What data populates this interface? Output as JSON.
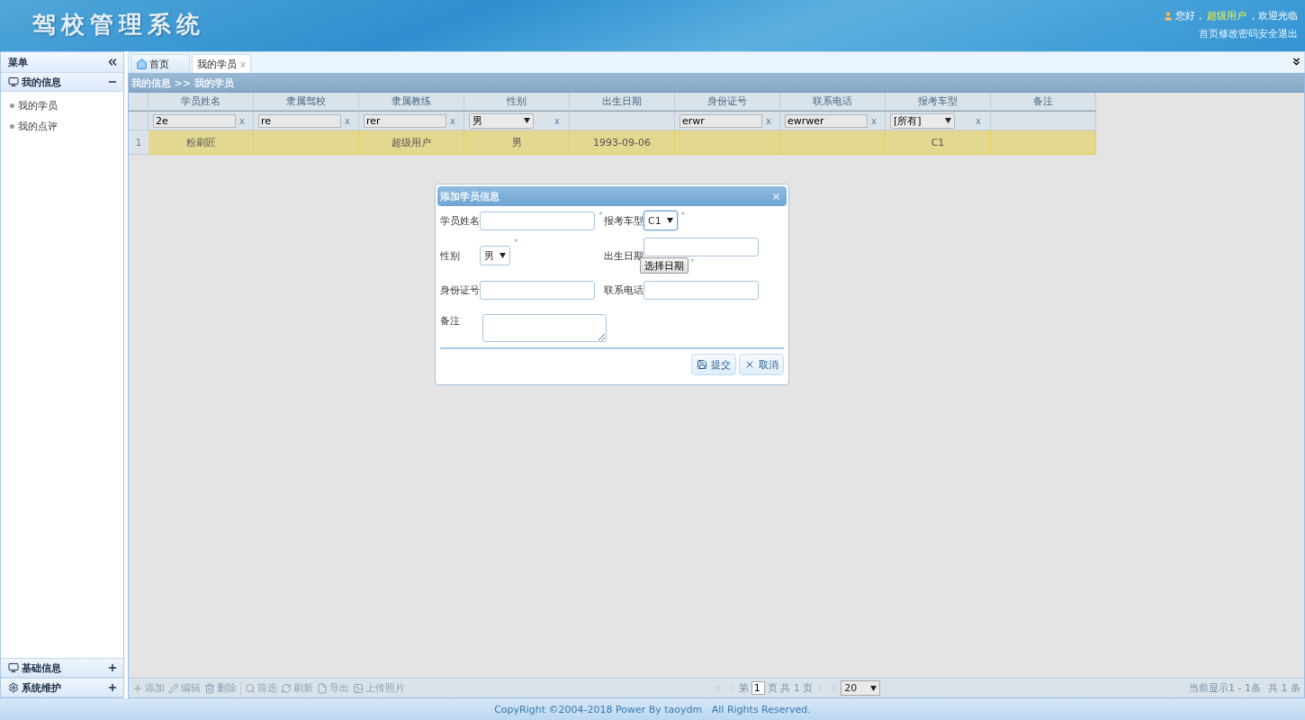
{
  "header": {
    "title": "驾校管理系统",
    "greeting": "您好，",
    "user": "超级用户",
    "welcome": "，欢迎光临",
    "links": [
      "首页",
      "修改密码",
      "安全退出"
    ]
  },
  "sidebar": {
    "title": "菜单",
    "groups": [
      {
        "label": "我的信息",
        "kind": "monitor",
        "expanded": true,
        "items": [
          {
            "label": "我的学员"
          },
          {
            "label": "我的点评"
          }
        ]
      },
      {
        "label": "基础信息",
        "kind": "monitor",
        "expanded": false
      },
      {
        "label": "系统维护",
        "kind": "gear",
        "expanded": false
      }
    ]
  },
  "tabs": [
    {
      "label": "首页",
      "kind": "home",
      "selected": false
    },
    {
      "label": "我的学员",
      "kind": "plain",
      "selected": true,
      "close": "x"
    }
  ],
  "breadcrumb": "我的信息 >> 我的学员",
  "grid": {
    "columns": [
      "学员姓名",
      "隶属驾校",
      "隶属教练",
      "性别",
      "出生日期",
      "身份证号",
      "联系电话",
      "报考车型",
      "备注"
    ],
    "filters": [
      {
        "kind": "text",
        "value": "2e",
        "clear": "x"
      },
      {
        "kind": "text",
        "value": "re",
        "clear": "x"
      },
      {
        "kind": "text",
        "value": "rer",
        "clear": "x"
      },
      {
        "kind": "select",
        "value": "男",
        "clear": "x"
      },
      {
        "kind": "none"
      },
      {
        "kind": "text",
        "value": "erwr",
        "clear": "x"
      },
      {
        "kind": "text",
        "value": "ewrwer",
        "clear": "x"
      },
      {
        "kind": "select",
        "value": "[所有]",
        "clear": "x"
      },
      {
        "kind": "none"
      }
    ],
    "rows": [
      {
        "number": "1",
        "selected": true,
        "cells": [
          "粉刷匠",
          "",
          "超级用户",
          "男",
          "1993-09-06",
          "",
          "",
          "C1",
          ""
        ]
      }
    ]
  },
  "toolbar": [
    {
      "label": "添加",
      "kind": "add"
    },
    {
      "label": "编辑",
      "kind": "edit"
    },
    {
      "label": "删除",
      "kind": "delete"
    },
    {
      "label": "筛选",
      "kind": "search"
    },
    {
      "label": "刷新",
      "kind": "refresh"
    },
    {
      "label": "导出",
      "kind": "file"
    },
    {
      "label": "上传照片",
      "kind": "image"
    }
  ],
  "pager": {
    "before": "第",
    "page": "1",
    "after": "页 共 1 页",
    "page_size": "20",
    "summary": "当前显示1 - 1条",
    "total": "共 1 条"
  },
  "dialog": {
    "title": "添加学员信息",
    "fields": [
      {
        "label": "学员姓名",
        "kind": "text",
        "mark": "*"
      },
      {
        "label": "报考车型",
        "kind": "select",
        "value": "C1",
        "mark": "*",
        "focused": true
      },
      {
        "label": "性别",
        "kind": "select",
        "value": "男",
        "mark": "*",
        "focused": false
      },
      {
        "label": "出生日期",
        "kind": "date",
        "button": "选择日期",
        "mark": "*"
      },
      {
        "label": "身份证号",
        "kind": "text"
      },
      {
        "label": "联系电话",
        "kind": "text"
      },
      {
        "label": "备注",
        "kind": "textarea"
      }
    ],
    "buttons": [
      {
        "label": "提交",
        "kind": "save"
      },
      {
        "label": "取消",
        "kind": "cancel"
      }
    ]
  },
  "footer": "CopyRight ©2004-2018 Power By taoydm   All Rights Reserved."
}
